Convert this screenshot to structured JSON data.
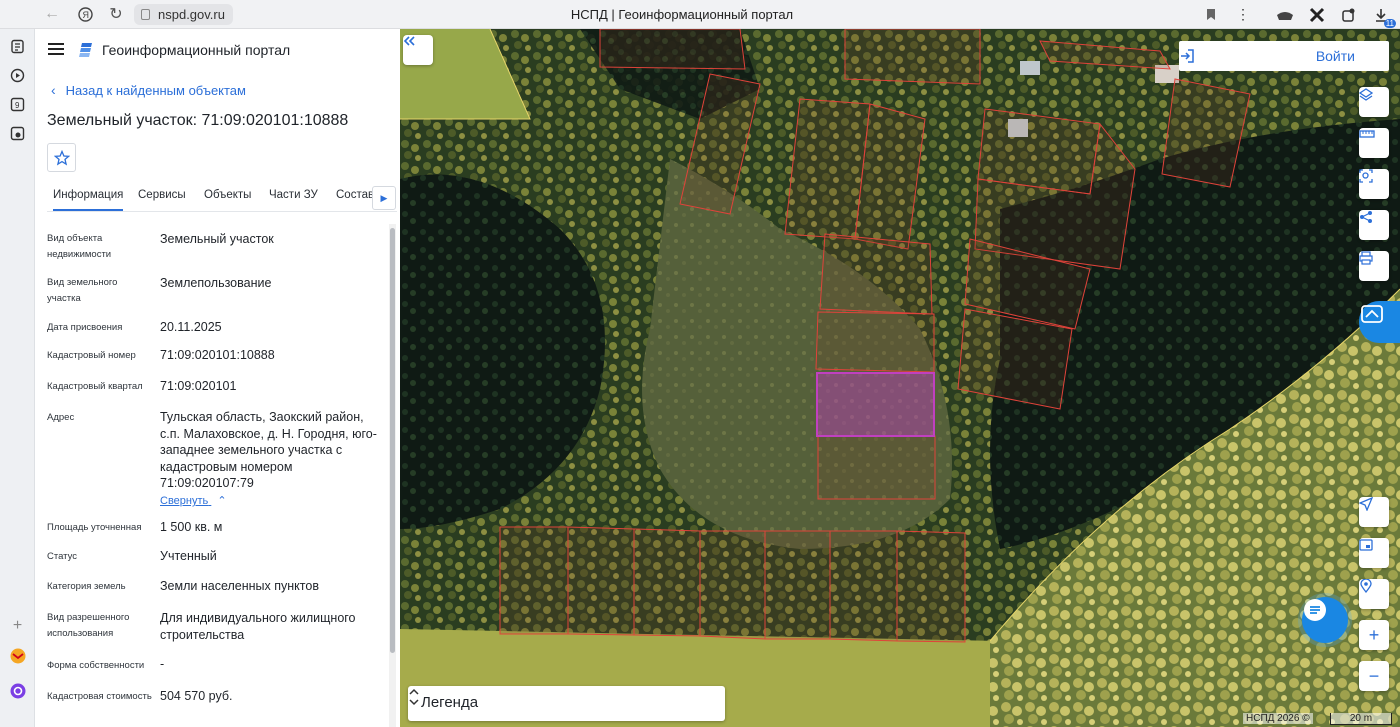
{
  "browser": {
    "url": "nspd.gov.ru",
    "tab_title": "НСПД | Геоинформационный портал",
    "badge_count": "11"
  },
  "panel": {
    "portal_title": "Геоинформационный портал",
    "back_label": "Назад к найденным объектам",
    "object_title": "Земельный участок: 71:09:020101:10888",
    "tabs": [
      {
        "label": "Информация",
        "active": true
      },
      {
        "label": "Сервисы"
      },
      {
        "label": "Объекты"
      },
      {
        "label": "Части ЗУ"
      },
      {
        "label": "Состав"
      }
    ],
    "rows": [
      {
        "label": "Вид объекта недвижимости",
        "value": "Земельный участок"
      },
      {
        "label": "Вид земельного участка",
        "value": "Землепользование"
      },
      {
        "label": "Дата присвоения",
        "value": "20.11.2025"
      },
      {
        "label": "Кадастровый номер",
        "value": "71:09:020101:10888"
      },
      {
        "label": "Кадастровый квартал",
        "value": "71:09:020101"
      },
      {
        "label": "Адрес",
        "value": "Тульская область, Заокский район, с.п. Малаховское, д. Н. Городня, юго-западнее земельного участка с кадастровым номером 71:09:020107:79"
      },
      {
        "label": "Площадь уточненная",
        "value": "1 500 кв. м"
      },
      {
        "label": "Статус",
        "value": "Учтенный"
      },
      {
        "label": "Категория земель",
        "value": "Земли населенных пунктов"
      },
      {
        "label": "Вид разрешенного использования",
        "value": "Для индивидуального жилищного строительства"
      },
      {
        "label": "Форма собственности",
        "value": "-"
      },
      {
        "label": "Кадастровая стоимость",
        "value": "504 570 руб."
      }
    ],
    "collapse_label": "Свернуть"
  },
  "map": {
    "login_label": "Войти",
    "legend_label": "Легенда",
    "copyright": "НСПД 2026 ©",
    "scale_label": "20 m",
    "colors": {
      "accent": "#2c6fd8",
      "parcel_border": "#e0433a",
      "selected_parcel": "#c040c0",
      "fab": "#1a87e3"
    }
  }
}
